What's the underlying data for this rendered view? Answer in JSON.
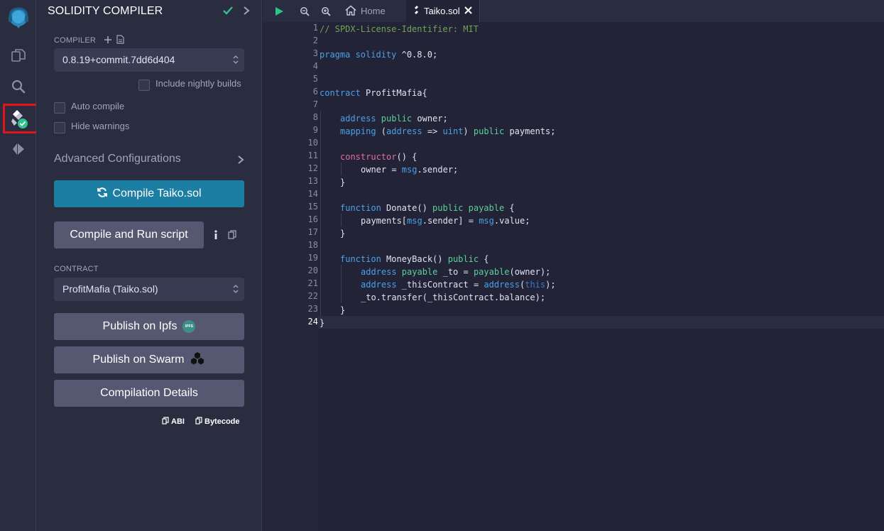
{
  "panel": {
    "title": "SOLIDITY COMPILER",
    "compiler_label": "COMPILER",
    "compiler_version": "0.8.19+commit.7dd6d404",
    "nightly_label": "Include nightly builds",
    "auto_compile_label": "Auto compile",
    "hide_warnings_label": "Hide warnings",
    "advanced_label": "Advanced Configurations",
    "compile_button": "Compile Taiko.sol",
    "compile_run_button": "Compile and Run script",
    "contract_label": "CONTRACT",
    "contract_selected": "ProfitMafia (Taiko.sol)",
    "publish_ipfs": "Publish on Ipfs",
    "ipfs_badge": "IPFS",
    "publish_swarm": "Publish on Swarm",
    "compilation_details": "Compilation Details",
    "abi_label": "ABI",
    "bytecode_label": "Bytecode"
  },
  "tabs": {
    "home": "Home",
    "file": "Taiko.sol"
  },
  "editor": {
    "line_numbers": [
      "1",
      "2",
      "3",
      "4",
      "5",
      "6",
      "7",
      "8",
      "9",
      "10",
      "11",
      "12",
      "13",
      "14",
      "15",
      "16",
      "17",
      "18",
      "19",
      "20",
      "21",
      "22",
      "23",
      "24"
    ],
    "current_line": "24",
    "lines": {
      "l1": "// SPDX-License-Identifier: MIT",
      "l3_kw": "pragma solidity",
      "l3_ver": " ^0.8.0;",
      "l6_kw": "contract",
      "l6_name": " ProfitMafia{",
      "l8_ty": "address",
      "l8_mod": " public",
      "l8_rest": " owner;",
      "l9_kw": "mapping",
      "l9_a": " (",
      "l9_ty1": "address",
      "l9_arrow": " => ",
      "l9_ty2": "uint",
      "l9_b": ") ",
      "l9_mod": "public",
      "l9_rest": " payments;",
      "l11_fn": "constructor",
      "l11_rest": "() {",
      "l12_a": "owner = ",
      "l12_msg": "msg",
      "l12_rest": ".sender;",
      "l13": "}",
      "l15_kw": "function",
      "l15_name": " Donate() ",
      "l15_mod": "public payable",
      "l15_rest": " {",
      "l16_a": "payments[",
      "l16_msg1": "msg",
      "l16_b": ".sender] = ",
      "l16_msg2": "msg",
      "l16_rest": ".value;",
      "l17": "}",
      "l19_kw": "function",
      "l19_name": " MoneyBack() ",
      "l19_mod": "public",
      "l19_rest": " {",
      "l20_ty": "address",
      "l20_mod": " payable",
      "l20_a": " _to = ",
      "l20_fn": "payable",
      "l20_rest": "(owner);",
      "l21_ty": "address",
      "l21_a": " _thisContract = ",
      "l21_fn": "address",
      "l21_b": "(",
      "l21_this": "this",
      "l21_rest": ");",
      "l22": "_to.transfer(_thisContract.balance);",
      "l23": "}",
      "l24": "}"
    }
  },
  "colors": {
    "accent": "#1c7ea3",
    "success": "#2fc28a",
    "highlight_frame": "#e4151a"
  }
}
